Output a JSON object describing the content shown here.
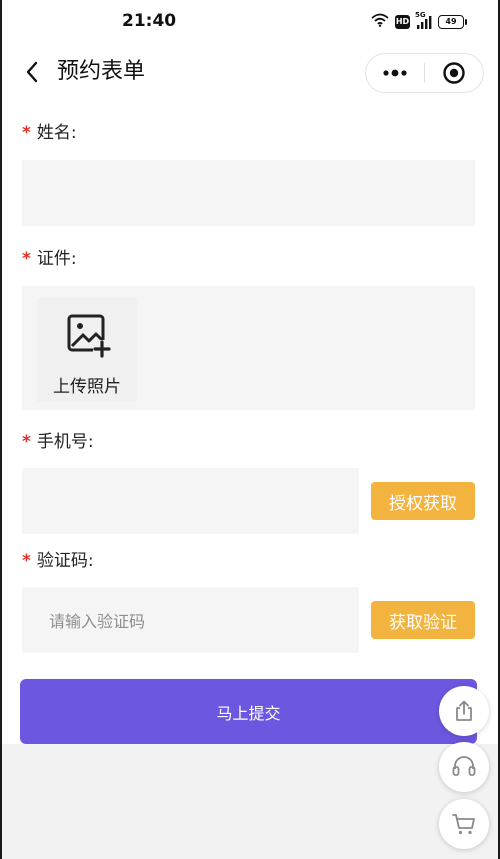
{
  "status_bar": {
    "time": "21:40",
    "hd": "HD",
    "network": "5G",
    "battery": "49",
    "icons": [
      "wifi-icon",
      "hd-icon",
      "signal-icon",
      "battery-icon"
    ]
  },
  "nav": {
    "title": "预约表单",
    "back_icon": "chevron-left-icon",
    "more_icon": "more-dots-icon",
    "close_icon": "target-close-icon"
  },
  "form": {
    "name": {
      "required": "*",
      "label": "姓名:",
      "value": ""
    },
    "id_card": {
      "required": "*",
      "label": "证件:",
      "upload_text": "上传照片",
      "upload_icon": "image-add-icon"
    },
    "phone": {
      "required": "*",
      "label": "手机号:",
      "value": "",
      "button": "授权获取"
    },
    "code": {
      "required": "*",
      "label": "验证码:",
      "placeholder": "请输入验证码",
      "button": "获取验证"
    },
    "submit": "马上提交"
  },
  "floating": {
    "share_icon": "share-icon",
    "support_icon": "headset-icon",
    "cart_icon": "cart-icon"
  },
  "colors": {
    "required": "#d9342b",
    "accent_orange": "#f2b43f",
    "submit_purple": "#6c57e0",
    "field_bg": "#f5f5f5"
  }
}
